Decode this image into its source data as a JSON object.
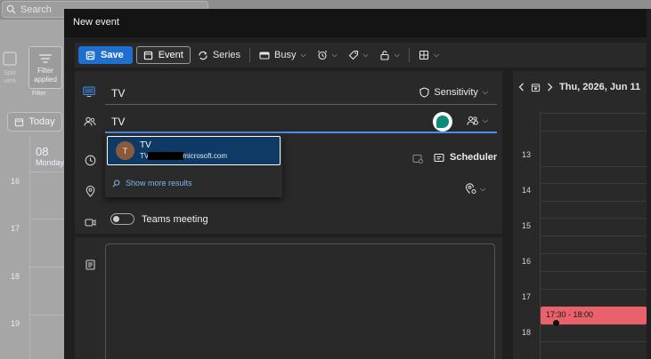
{
  "background": {
    "search_placeholder": "Search",
    "ribbon_split_label": "Split view",
    "ribbon_filter_label": "Filter applied",
    "ribbon_group_label": "Filter",
    "today_label": "Today",
    "day_number": "08",
    "day_name": "Monday",
    "hours": [
      "16",
      "17",
      "18",
      "19"
    ]
  },
  "modal": {
    "title": "New event",
    "toolbar": {
      "save_label": "Save",
      "event_label": "Event",
      "series_label": "Series",
      "busy_label": "Busy"
    },
    "form": {
      "title_value": "TV",
      "sensitivity_label": "Sensitivity",
      "attendee_value": "TV",
      "scheduler_label": "Scheduler",
      "teams_label": "Teams meeting"
    },
    "suggestion": {
      "avatar_initial": "T",
      "name": "TV",
      "email_prefix": "TV",
      "email_suffix": "microsoft.com",
      "show_more_label": "Show more results"
    },
    "calendar": {
      "date_label": "Thu, 2026, Jun 11",
      "hours": [
        "13",
        "14",
        "15",
        "16",
        "17",
        "18"
      ],
      "event_time": "17:30 - 18:00",
      "event_color": "#e8616b"
    }
  },
  "colors": {
    "accent": "#1f6fd1",
    "focus_underline": "#4a8ff0",
    "suggestion_bg": "#0f3a66"
  }
}
